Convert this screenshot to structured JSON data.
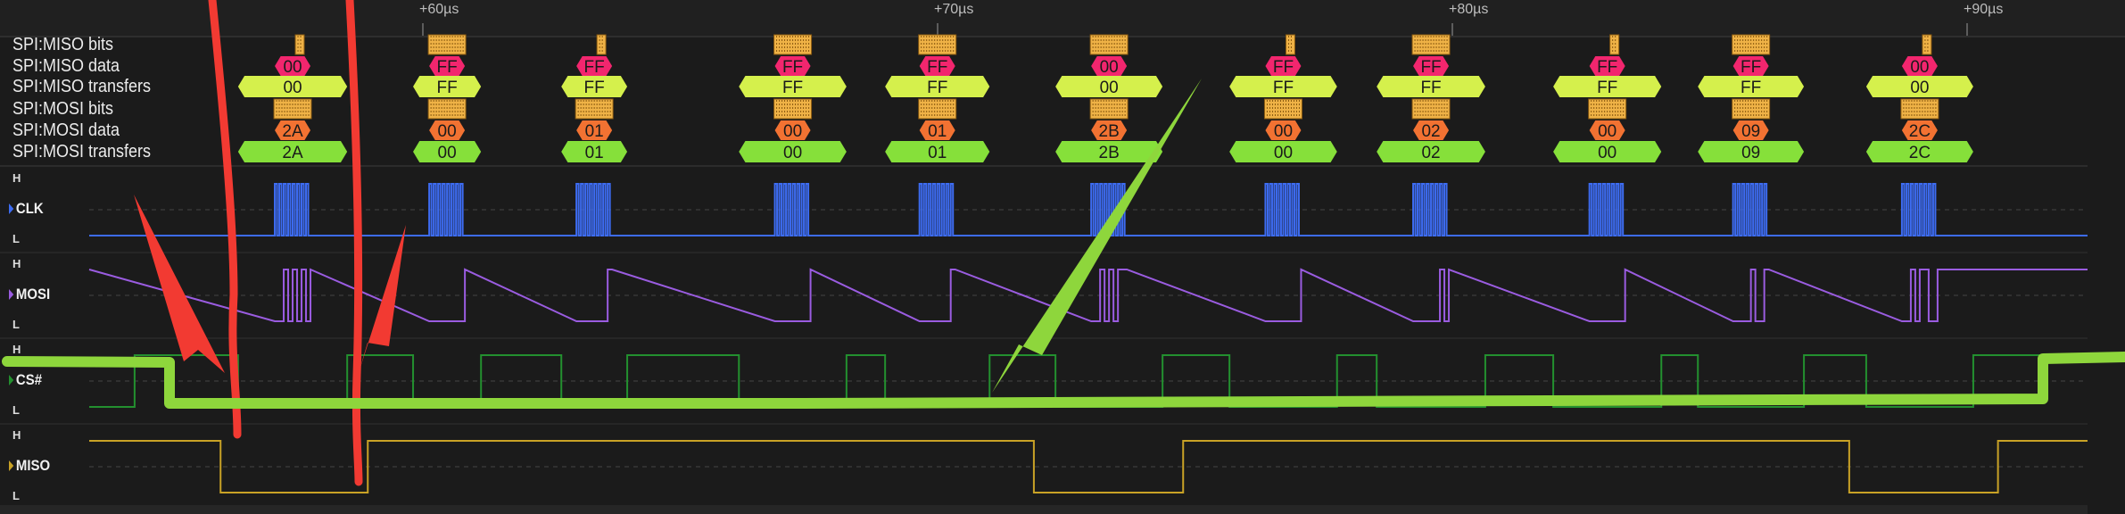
{
  "ruler": {
    "ticks": [
      {
        "label": "+60µs",
        "us": 60
      },
      {
        "label": "+70µs",
        "us": 70
      },
      {
        "label": "+80µs",
        "us": 80
      },
      {
        "label": "+90µs",
        "us": 90
      }
    ]
  },
  "decoder_rows": [
    "SPI:MISO bits",
    "SPI:MISO data",
    "SPI:MISO transfers",
    "SPI:MOSI bits",
    "SPI:MOSI data",
    "SPI:MOSI transfers"
  ],
  "channels": [
    {
      "name": "CLK",
      "color": "#3d6cf2",
      "high": "H",
      "low": "L"
    },
    {
      "name": "MOSI",
      "color": "#9a5ce0",
      "high": "H",
      "low": "L"
    },
    {
      "name": "CS#",
      "color": "#23902f",
      "high": "H",
      "low": "L"
    },
    {
      "name": "MISO",
      "color": "#c9a226",
      "high": "H",
      "low": "L"
    }
  ],
  "colors": {
    "miso_data": "#f2266e",
    "mosi_data": "#f27232",
    "miso_transfer": "#d5f04c",
    "mosi_transfer": "#86e03a",
    "bits": "#efb246",
    "annotation_red": "#f23a32",
    "annotation_green": "#8ed63c"
  },
  "transfers": [
    {
      "start_us": 56.41,
      "end_us": 58.53,
      "miso": "00",
      "mosi": "2A"
    },
    {
      "start_us": 59.81,
      "end_us": 61.13,
      "miso": "FF",
      "mosi": "00"
    },
    {
      "start_us": 62.69,
      "end_us": 63.97,
      "miso": "FF",
      "mosi": "01"
    },
    {
      "start_us": 66.14,
      "end_us": 68.23,
      "miso": "FF",
      "mosi": "00"
    },
    {
      "start_us": 68.98,
      "end_us": 71.01,
      "miso": "FF",
      "mosi": "01"
    },
    {
      "start_us": 72.29,
      "end_us": 74.37,
      "miso": "00",
      "mosi": "2B"
    },
    {
      "start_us": 75.67,
      "end_us": 77.76,
      "miso": "FF",
      "mosi": "00"
    },
    {
      "start_us": 78.53,
      "end_us": 80.64,
      "miso": "FF",
      "mosi": "02"
    },
    {
      "start_us": 81.96,
      "end_us": 84.06,
      "miso": "FF",
      "mosi": "00"
    },
    {
      "start_us": 84.77,
      "end_us": 86.83,
      "miso": "FF",
      "mosi": "09"
    },
    {
      "start_us": 88.04,
      "end_us": 90.12,
      "miso": "00",
      "mosi": "2C"
    }
  ],
  "miso_low_intervals_us": [
    [
      56.07,
      58.93
    ],
    [
      71.87,
      74.77
    ],
    [
      87.71,
      90.6
    ]
  ]
}
